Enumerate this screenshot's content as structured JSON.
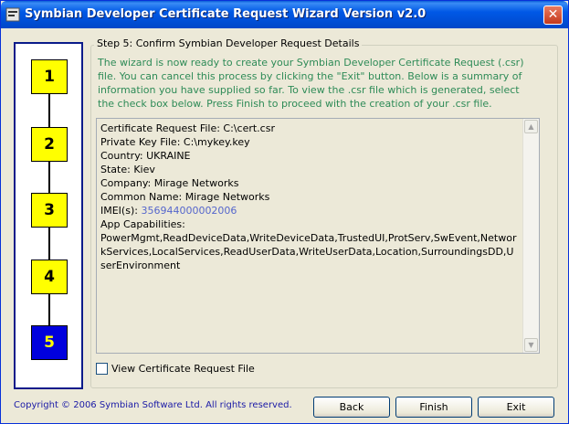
{
  "window": {
    "title": "Symbian Developer Certificate Request Wizard Version v2.0",
    "close_glyph": "✕"
  },
  "steps": [
    {
      "label": "1",
      "active": false
    },
    {
      "label": "2",
      "active": false
    },
    {
      "label": "3",
      "active": false
    },
    {
      "label": "4",
      "active": false
    },
    {
      "label": "5",
      "active": true
    }
  ],
  "group": {
    "legend": "Step 5: Confirm Symbian Developer Request Details",
    "intro": "The wizard is now ready to create your Symbian Developer Certificate Request (.csr) file. You can cancel this process by clicking the \"Exit\" button. Below is a summary of information you have supplied so far. To view the .csr file which is generated, select the check box below. Press Finish to proceed with the creation of your .csr file."
  },
  "summary": {
    "cert_file": "Certificate Request File: C:\\cert.csr",
    "key_file": "Private Key File: C:\\mykey.key",
    "country": "Country: UKRAINE",
    "state": "State: Kiev",
    "company": "Company: Mirage Networks",
    "common_name": "Common Name: Mirage Networks",
    "imei_label": "IMEI(s):",
    "imei_value": "356944000002006",
    "caps_label": "App Capabilities:",
    "caps_value": "PowerMgmt,ReadDeviceData,WriteDeviceData,TrustedUI,ProtServ,SwEvent,NetworkServices,LocalServices,ReadUserData,WriteUserData,Location,SurroundingsDD,UserEnvironment"
  },
  "checkbox": {
    "label": "View Certificate Request File",
    "checked": false
  },
  "footer": {
    "copyright": "Copyright © 2006 Symbian Software Ltd. All rights reserved.",
    "back": "Back",
    "finish": "Finish",
    "exit": "Exit"
  },
  "colors": {
    "title_bar": "#0055e5",
    "step_box": "#ffff00",
    "step_active": "#0000dd",
    "intro_text": "#2e8b57",
    "copyright_text": "#1a1aa6"
  }
}
